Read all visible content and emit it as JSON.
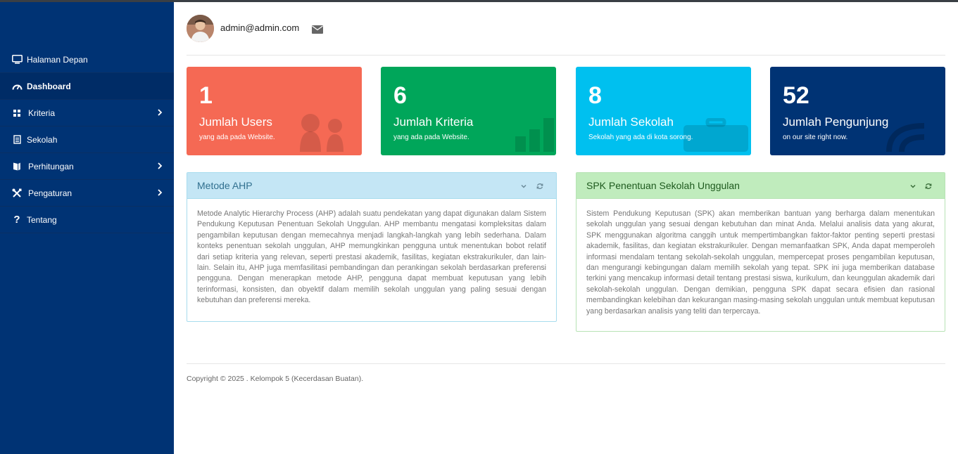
{
  "sidebar": {
    "items": [
      {
        "label": "Halaman Depan",
        "icon": "monitor-icon",
        "active": false,
        "has_submenu": false
      },
      {
        "label": "Dashboard",
        "icon": "speedometer-icon",
        "active": true,
        "has_submenu": false
      },
      {
        "label": "Kriteria",
        "icon": "grid-icon",
        "active": false,
        "has_submenu": true
      },
      {
        "label": "Sekolah",
        "icon": "document-icon",
        "active": false,
        "has_submenu": false
      },
      {
        "label": "Perhitungan",
        "icon": "book-icon",
        "active": false,
        "has_submenu": true
      },
      {
        "label": "Pengaturan",
        "icon": "tools-icon",
        "active": false,
        "has_submenu": true
      },
      {
        "label": "Tentang",
        "icon": "question-icon",
        "active": false,
        "has_submenu": false
      }
    ]
  },
  "header": {
    "user_email": "admin@admin.com",
    "mail_icon": "envelope-icon"
  },
  "cards": [
    {
      "number": "1",
      "label": "Jumlah Users",
      "sub": "yang ada pada Website.",
      "color": "#f56954",
      "icon": "users-icon"
    },
    {
      "number": "6",
      "label": "Jumlah Kriteria",
      "sub": "yang ada pada Website.",
      "color": "#00a65a",
      "icon": "bar-chart-icon"
    },
    {
      "number": "8",
      "label": "Jumlah Sekolah",
      "sub": "Sekolah yang ada di kota sorong.",
      "color": "#00c0ef",
      "icon": "briefcase-icon"
    },
    {
      "number": "52",
      "label": "Jumlah Pengunjung",
      "sub": "on our site right now.",
      "color": "#003374",
      "icon": "signal-icon"
    }
  ],
  "panels": [
    {
      "title": "Metode AHP",
      "body": "Metode Analytic Hierarchy Process (AHP) adalah suatu pendekatan yang dapat digunakan dalam Sistem Pendukung Keputusan Penentuan Sekolah Unggulan. AHP membantu mengatasi kompleksitas dalam pengambilan keputusan dengan memecahnya menjadi langkah-langkah yang lebih sederhana. Dalam konteks penentuan sekolah unggulan, AHP memungkinkan pengguna untuk menentukan bobot relatif dari setiap kriteria yang relevan, seperti prestasi akademik, fasilitas, kegiatan ekstrakurikuler, dan lain-lain. Selain itu, AHP juga memfasilitasi pembandingan dan perankingan sekolah berdasarkan preferensi pengguna. Dengan menerapkan metode AHP, pengguna dapat membuat keputusan yang lebih terinformasi, konsisten, dan obyektif dalam memilih sekolah unggulan yang paling sesuai dengan kebutuhan dan preferensi mereka.",
      "header_bg": "#c4e6f5",
      "border": "#a8dcee",
      "title_color": "#31708f"
    },
    {
      "title": "SPK Penentuan Sekolah Unggulan",
      "body": "Sistem Pendukung Keputusan (SPK) akan memberikan bantuan yang berharga dalam menentukan sekolah unggulan yang sesuai dengan kebutuhan dan minat Anda. Melalui analisis data yang akurat, SPK menggunakan algoritma canggih untuk mempertimbangkan faktor-faktor penting seperti prestasi akademik, fasilitas, dan kegiatan ekstrakurikuler. Dengan memanfaatkan SPK, Anda dapat memperoleh informasi mendalam tentang sekolah-sekolah unggulan, mempercepat proses pengambilan keputusan, dan mengurangi kebingungan dalam memilih sekolah yang tepat. SPK ini juga memberikan database terkini yang mencakup informasi detail tentang prestasi siswa, kurikulum, dan keunggulan akademik dari sekolah-sekolah unggulan. Dengan demikian, pengguna SPK dapat secara efisien dan rasional membandingkan kelebihan dan kekurangan masing-masing sekolah unggulan untuk membuat keputusan yang berdasarkan analisis yang teliti dan terpercaya.",
      "header_bg": "#c0ecbd",
      "border": "#b7e3b4",
      "title_color": "#1e5a1e"
    }
  ],
  "footer": {
    "text": "Copyright © 2025 . Kelompok 5 (Kecerdasan Buatan)."
  }
}
